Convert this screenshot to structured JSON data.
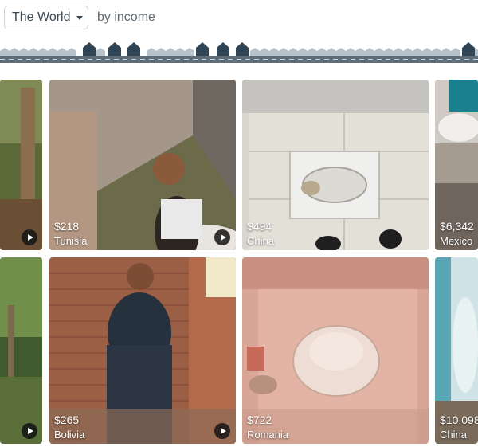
{
  "header": {
    "world_select_label": "The World",
    "by_income_label": "by income"
  },
  "tiles": [
    {
      "income": "",
      "country": ""
    },
    {
      "income": "$218",
      "country": "Tunisia"
    },
    {
      "income": "$494",
      "country": "China"
    },
    {
      "income": "$6,342",
      "country": "Mexico"
    },
    {
      "income": "",
      "country": ""
    },
    {
      "income": "$265",
      "country": "Bolivia"
    },
    {
      "income": "$722",
      "country": "Romania"
    },
    {
      "income": "$10,098",
      "country": "China"
    }
  ]
}
